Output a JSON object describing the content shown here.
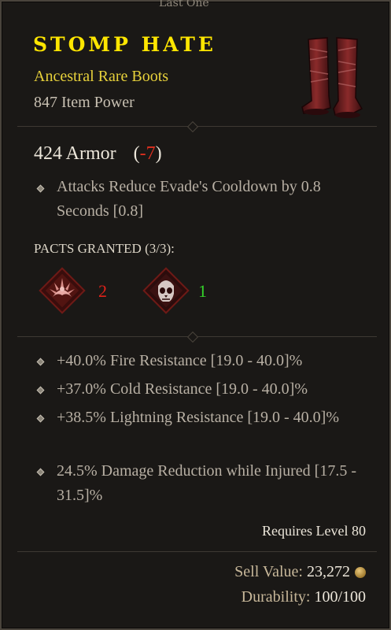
{
  "header_clip": "Last One",
  "item": {
    "name": "STOMP HATE",
    "type": "Ancestral Rare Boots",
    "item_power": "847 Item Power",
    "armor": {
      "value": "424 Armor",
      "open": "(",
      "delta": "-7",
      "close": ")"
    },
    "implicit": "Attacks Reduce Evade's Cooldown by 0.8 Seconds [0.8]",
    "pacts": {
      "label": "PACTS GRANTED (3/3):",
      "items": [
        {
          "icon": "ferocity-pact-icon",
          "count": "2",
          "color": "#e0221a"
        },
        {
          "icon": "divinity-pact-icon",
          "count": "1",
          "color": "#34d22a"
        }
      ]
    },
    "affixes": [
      "+40.0% Fire Resistance [19.0 - 40.0]%",
      "+37.0% Cold Resistance [19.0 - 40.0]%",
      "+38.5% Lightning Resistance [19.0 - 40.0]%",
      "24.5% Damage Reduction while Injured [17.5 - 31.5]%"
    ],
    "requires": "Requires Level 80",
    "sell": {
      "label": "Sell Value:",
      "value": "23,272"
    },
    "durability": {
      "label": "Durability:",
      "value": "100/100"
    }
  },
  "colors": {
    "title": "#ffe600",
    "rare": "#e7d13b",
    "negative": "#e0301f"
  }
}
